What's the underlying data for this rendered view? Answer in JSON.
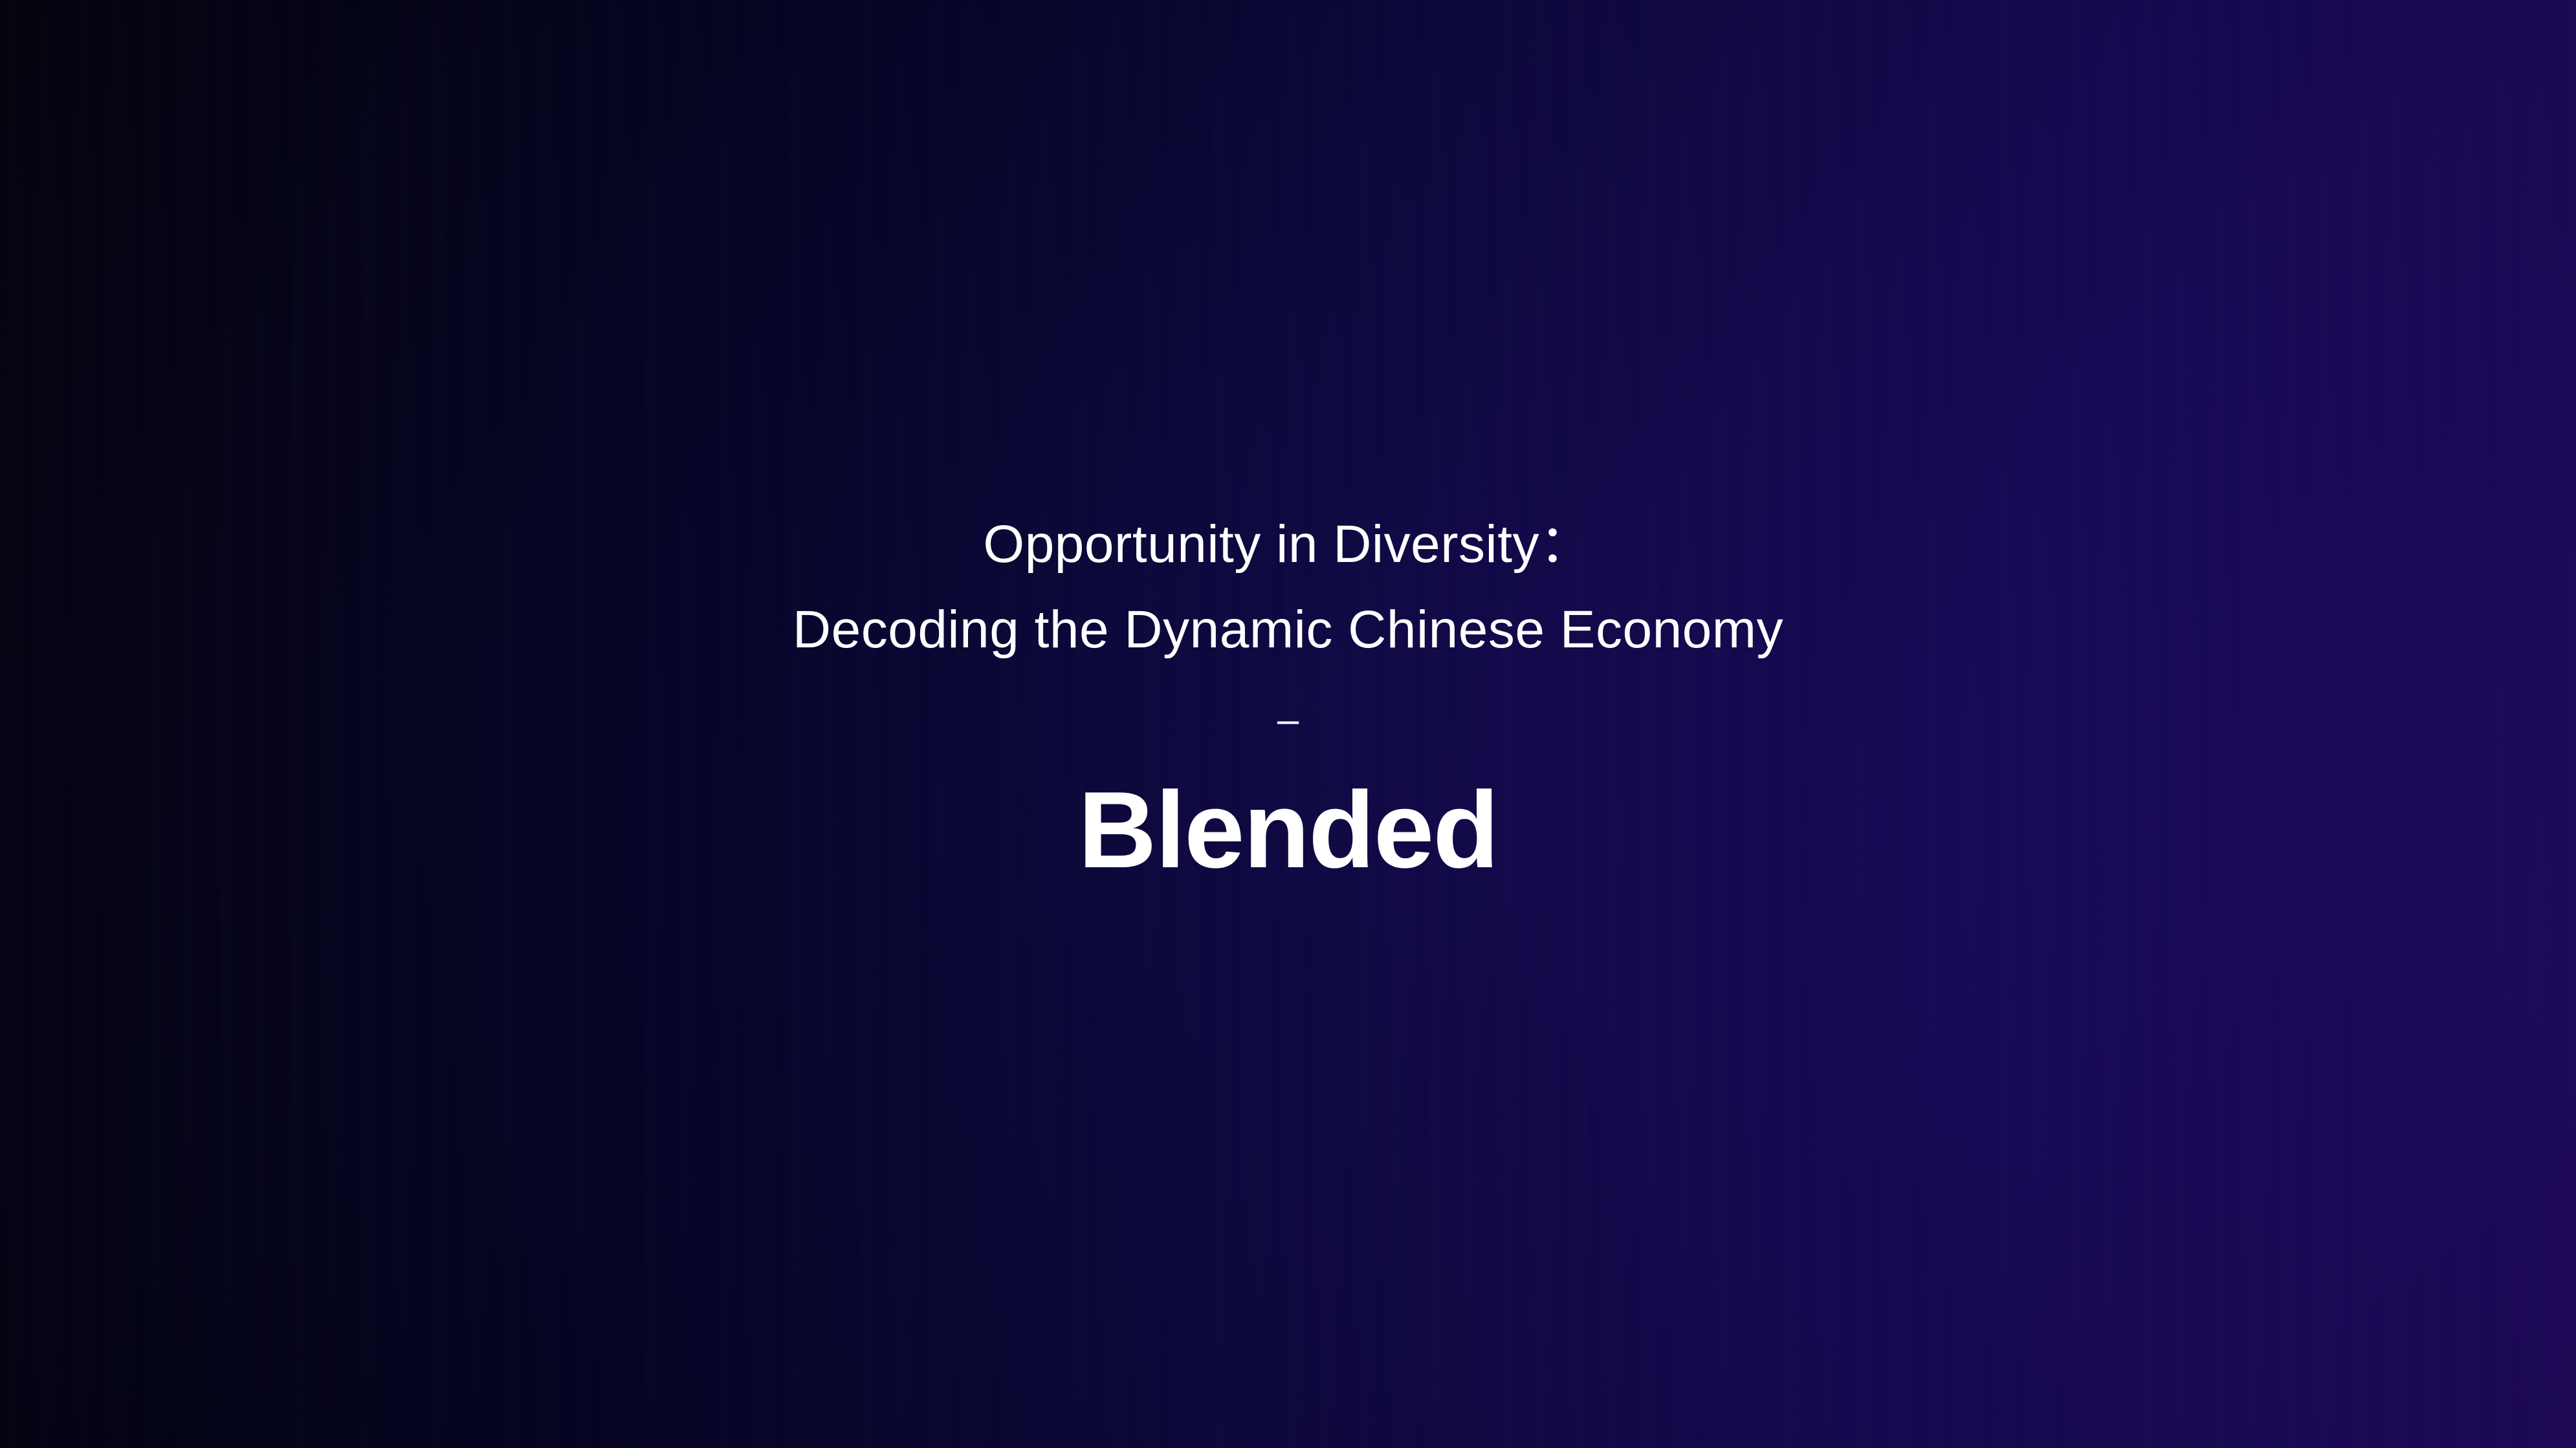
{
  "slide": {
    "title_line1": "Opportunity in Diversity：",
    "title_line2": "Decoding the Dynamic Chinese Economy",
    "separator": "–",
    "brand": "Blended"
  },
  "colors": {
    "background_left": "#04030f",
    "background_right": "#220a66",
    "text": "#ffffff"
  }
}
